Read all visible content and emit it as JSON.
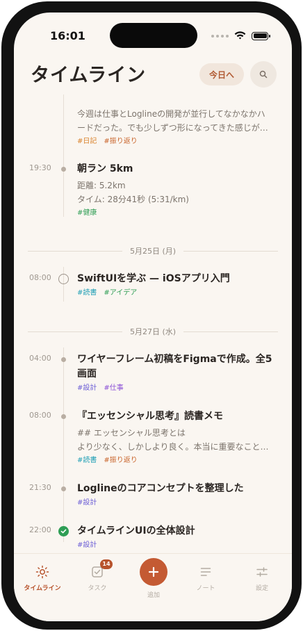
{
  "status_bar": {
    "time": "16:01"
  },
  "header": {
    "title": "タイムライン",
    "today_label": "今日へ"
  },
  "colors": {
    "accent": "#b7532c",
    "tag_diary": "#d9822b",
    "tag_review": "#c9652c",
    "tag_health": "#2f9e55",
    "tag_reading": "#1f9fb5",
    "tag_idea": "#2f9e55",
    "tag_design": "#6d5fd6",
    "tag_work": "#8a4fd6"
  },
  "entries": [
    {
      "time": "",
      "title": "",
      "lines": [
        "今週は仕事とLoglineの開発が並行してなかなかハ",
        "ードだった。でも少しずつ形になってきた感じが…"
      ],
      "tags": [
        {
          "text": "#日記",
          "color": "#d9822b"
        },
        {
          "text": "#振り返り",
          "color": "#c9652c"
        }
      ]
    },
    {
      "time": "19:30",
      "title": "朝ラン 5km",
      "lines": [
        "距離: 5.2km",
        "タイム: 28分41秒 (5:31/km)"
      ],
      "tags": [
        {
          "text": "#健康",
          "color": "#2f9e55"
        }
      ]
    },
    {
      "time": "08:00",
      "title": "SwiftUIを学ぶ — iOSアプリ入門",
      "lines": [],
      "tags": [
        {
          "text": "#読書",
          "color": "#1f9fb5"
        },
        {
          "text": "#アイデア",
          "color": "#2f9e55"
        }
      ]
    },
    {
      "time": "04:00",
      "title": "ワイヤーフレーム初稿をFigmaで作成。全5",
      "title2": "画面",
      "lines": [],
      "tags": [
        {
          "text": "#設計",
          "color": "#6d5fd6"
        },
        {
          "text": "#仕事",
          "color": "#8a4fd6"
        }
      ]
    },
    {
      "time": "08:00",
      "title": "『エッセンシャル思考』読書メモ",
      "lines": [
        "## エッセンシャル思考とは",
        "より少なく、しかしより良く。本当に重要なこと…"
      ],
      "tags": [
        {
          "text": "#読書",
          "color": "#1f9fb5"
        },
        {
          "text": "#振り返り",
          "color": "#c9652c"
        }
      ]
    },
    {
      "time": "21:30",
      "title": "Loglineのコアコンセプトを整理した",
      "lines": [],
      "tags": [
        {
          "text": "#設計",
          "color": "#6d5fd6"
        }
      ]
    },
    {
      "time": "22:00",
      "title": "タイムラインUIの全体設計",
      "lines": [],
      "tags": [
        {
          "text": "#設計",
          "color": "#6d5fd6"
        }
      ]
    }
  ],
  "date_separators": [
    "5月25日 (月)",
    "5月27日 (水)"
  ],
  "tabbar": {
    "timeline": "タイムライン",
    "tasks": "タスク",
    "tasks_badge": "14",
    "add": "追加",
    "notes": "ノート",
    "settings": "設定"
  }
}
